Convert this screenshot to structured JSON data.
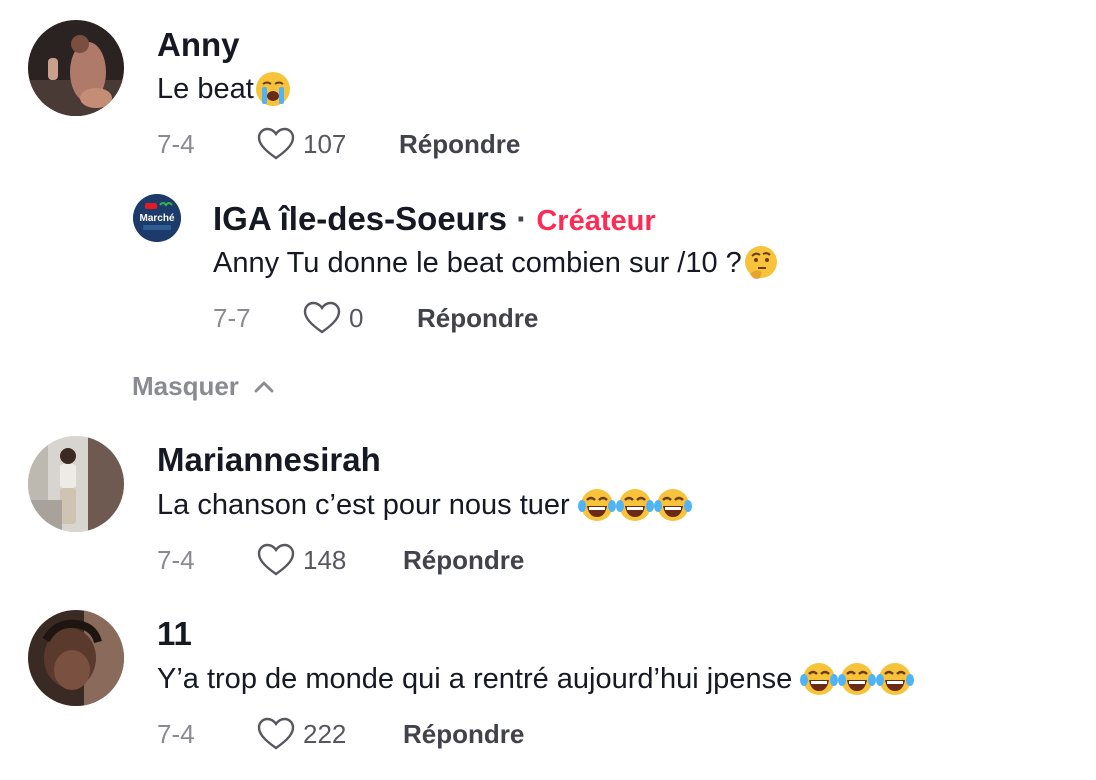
{
  "comments": [
    {
      "author": "Anny",
      "text": "Le beat",
      "emoji": "loudly-crying-face",
      "date": "7-4",
      "likes": "107",
      "reply_label": "Répondre"
    },
    {
      "author": "Mariannesirah",
      "text": "La chanson c’est pour nous tuer ",
      "emoji": "face-with-tears-of-joy x3",
      "date": "7-4",
      "likes": "148",
      "reply_label": "Répondre"
    },
    {
      "author": "11",
      "text": "Y’a trop de monde qui a rentré aujourd’hui jpense ",
      "emoji": "face-with-tears-of-joy x3",
      "date": "7-4",
      "likes": "222",
      "reply_label": "Répondre"
    }
  ],
  "reply": {
    "author": "IGA île-des-Soeurs",
    "separator": " · ",
    "badge": "Créateur",
    "text": "Anny Tu donne le beat combien sur /10 ? ",
    "emoji": "thinking-face",
    "date": "7-7",
    "likes": "0",
    "reply_label": "Répondre",
    "avatar_text_top": "IGA",
    "avatar_text_main": "Marché",
    "avatar_text_sub": "île-des-Sœurs"
  },
  "hide_replies_label": "Masquer",
  "colors": {
    "creator_badge": "#fe2c55",
    "meta_gray": "#8a8b91",
    "text": "#161823"
  }
}
